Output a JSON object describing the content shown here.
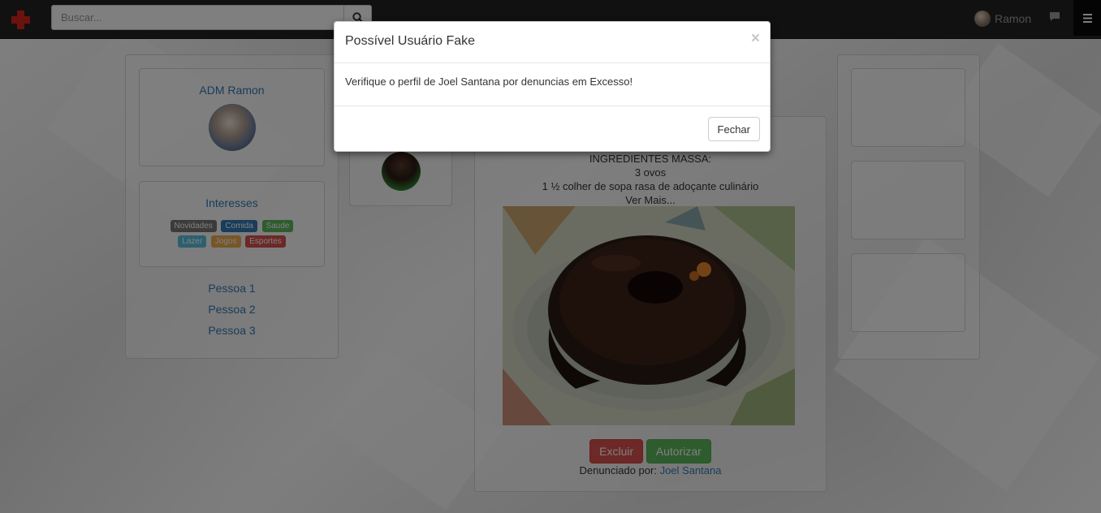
{
  "navbar": {
    "search_placeholder": "Buscar...",
    "user_name": "Ramon",
    "icons": [
      "red-cross-logo-icon",
      "search-icon",
      "chat-icon",
      "hamburger-menu-icon"
    ],
    "accent_color": "#d9251d"
  },
  "left_sidebar": {
    "profile_name": "ADM Ramon",
    "interests_title": "Interesses",
    "interest_tags": [
      {
        "label": "Novidades",
        "color": "#777777"
      },
      {
        "label": "Comida",
        "color": "#337ab7"
      },
      {
        "label": "Saude",
        "color": "#5cb85c"
      },
      {
        "label": "Lazer",
        "color": "#5bc0de"
      },
      {
        "label": "Jogos",
        "color": "#f0ad4e"
      },
      {
        "label": "Esportes",
        "color": "#d9534f"
      }
    ],
    "people": [
      "Pessoa 1",
      "Pessoa 2",
      "Pessoa 3"
    ]
  },
  "post": {
    "lines": [
      "INGREDIENTES MASSA:",
      "3 ovos",
      "1 ½ colher de sopa rasa de adoçante culinário"
    ],
    "see_more": "Ver Mais...",
    "delete_button": "Excluir",
    "authorize_button": "Autorizar",
    "reported_by_label": "Denunciado por:",
    "reported_by_name": "Joel Santana"
  },
  "modal": {
    "title": "Possível Usuário Fake",
    "close_symbol": "×",
    "body": "Verifique o perfil de Joel Santana por denuncias em Excesso!",
    "close_button": "Fechar"
  }
}
